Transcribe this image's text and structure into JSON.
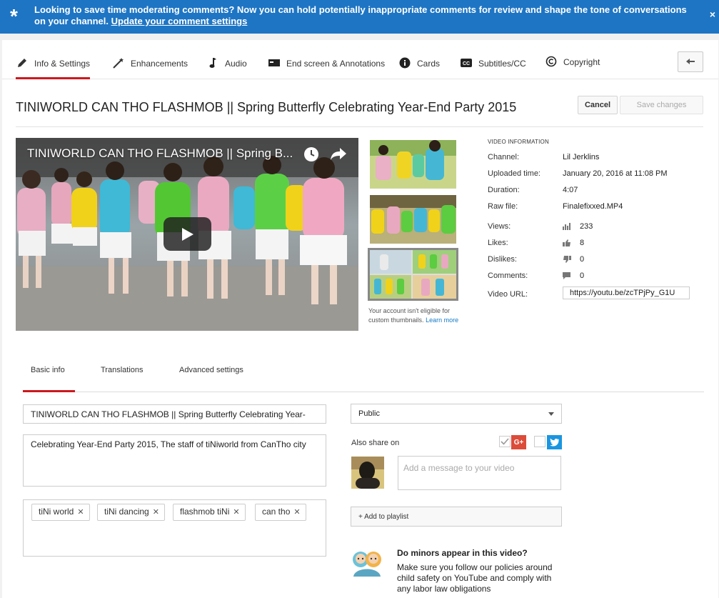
{
  "banner": {
    "text": "Looking to save time moderating comments? Now you can hold potentially inappropriate comments for review and shape the tone of conversations on your channel.",
    "link": "Update your comment settings",
    "close": "×"
  },
  "tabs": [
    {
      "label": "Info & Settings",
      "icon": "pencil-icon",
      "active": true
    },
    {
      "label": "Enhancements",
      "icon": "magic-wand-icon"
    },
    {
      "label": "Audio",
      "icon": "music-note-icon"
    },
    {
      "label": "End screen & Annotations",
      "icon": "end-screen-icon"
    },
    {
      "label": "Cards",
      "icon": "info-circle-icon"
    },
    {
      "label": "Subtitles/CC",
      "icon": "cc-icon"
    },
    {
      "label": "Copyright",
      "icon": "copyright-icon"
    }
  ],
  "header": {
    "title": "TINIWORLD CAN THO FLASHMOB || Spring Butterfly Celebrating Year-End Party 2015",
    "cancel": "Cancel",
    "save": "Save changes"
  },
  "player": {
    "title": "TINIWORLD CAN THO FLASHMOB || Spring B..."
  },
  "thumbnails": {
    "note": "Your account isn't eligible for custom thumbnails.",
    "learn_more": "Learn more"
  },
  "video_info": {
    "heading": "VIDEO INFORMATION",
    "channel_label": "Channel:",
    "channel": "Lil Jerklins",
    "uploaded_label": "Uploaded time:",
    "uploaded": "January 20, 2016 at 11:08 PM",
    "duration_label": "Duration:",
    "duration": "4:07",
    "raw_label": "Raw file:",
    "raw": "Finalefixxed.MP4",
    "views_label": "Views:",
    "views": "233",
    "likes_label": "Likes:",
    "likes": "8",
    "dislikes_label": "Dislikes:",
    "dislikes": "0",
    "comments_label": "Comments:",
    "comments": "0",
    "url_label": "Video URL:",
    "url": "https://youtu.be/zcTPjPy_G1U"
  },
  "subtabs": [
    "Basic info",
    "Translations",
    "Advanced settings"
  ],
  "form": {
    "title_value": "TINIWORLD CAN THO  FLASHMOB || Spring Butterfly Celebrating Year-",
    "description_value": "Celebrating Year-End Party 2015, The staff of tiNiworld from CanTho city",
    "tags": [
      "tiNi world",
      "tiNi dancing",
      "flashmob tiNi",
      "can tho"
    ],
    "privacy": "Public",
    "share_label": "Also share on",
    "gplus": "G+",
    "message_placeholder": "Add a message to your video",
    "playlist": "+ Add to playlist",
    "minors_heading": "Do minors appear in this video?",
    "minors_text": "Make sure you follow our policies around child safety on YouTube and comply with any labor law obligations"
  },
  "colors": {
    "banner": "#1e75c4",
    "active_tab": "#cc181e",
    "link": "#167ac6",
    "gplus": "#dd4b39",
    "twitter": "#1b95e0"
  }
}
